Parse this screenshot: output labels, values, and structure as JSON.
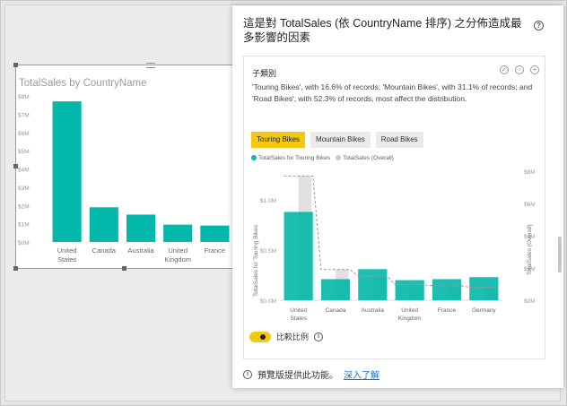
{
  "left_visual": {
    "title": "TotalSales by CountryName",
    "chart_data": {
      "type": "bar",
      "title": "TotalSales by CountryName",
      "categories": [
        "United States",
        "Canada",
        "Australia",
        "United Kingdom",
        "France"
      ],
      "category_lines": [
        [
          "United",
          "States"
        ],
        [
          "Canada"
        ],
        [
          "Australia"
        ],
        [
          "United",
          "Kingdom"
        ],
        [
          "France"
        ]
      ],
      "values": [
        7.7,
        1.9,
        1.5,
        0.95,
        0.9
      ],
      "y_ticks": [
        "$0M",
        "$1M",
        "$2M",
        "$3M",
        "$4M",
        "$5M",
        "$6M",
        "$7M",
        "$8M"
      ],
      "ylim": [
        0,
        8
      ],
      "color": "#01b8aa"
    }
  },
  "panel": {
    "title": "這是對 TotalSales (依 CountryName 排序) 之分佈造成最多影響的因素",
    "help_icon": "?",
    "card": {
      "heading": "子類別",
      "description": "'Touring Bikes', with 16.6% of records; 'Mountain Bikes', with 31.1% of records; and 'Road Bikes', with 52.3% of records, most affect the distribution.",
      "icons": [
        "thumbs-up-icon",
        "comment-icon",
        "add-icon"
      ],
      "buttons": [
        {
          "label": "Touring Bikes",
          "active": true
        },
        {
          "label": "Mountain Bikes",
          "active": false
        },
        {
          "label": "Road Bikes",
          "active": false
        }
      ],
      "legend": [
        {
          "label": "TotalSales for Touring Bikes",
          "color": "#01b8aa"
        },
        {
          "label": "TotalSales (Overall)",
          "color": "#c8c8c8"
        }
      ],
      "chart_data": {
        "type": "bar",
        "categories": [
          "United States",
          "Canada",
          "Australia",
          "United Kingdom",
          "France",
          "Germany"
        ],
        "category_lines": [
          [
            "United",
            "States"
          ],
          [
            "Canada"
          ],
          [
            "Australia"
          ],
          [
            "United",
            "Kingdom"
          ],
          [
            "France"
          ],
          [
            "Germany"
          ]
        ],
        "series": [
          {
            "name": "TotalSales for Touring Bikes",
            "axis": "left",
            "values": [
              0.88,
              0.21,
              0.31,
              0.2,
              0.21,
              0.23
            ],
            "color": "#01b8aa"
          },
          {
            "name": "TotalSales (Overall)",
            "axis": "right",
            "values": [
              7.7,
              1.9,
              1.5,
              0.95,
              0.9,
              0.8
            ],
            "color": "#c8c8c8"
          }
        ],
        "ylabel_left": "TotalSales for Touring Bikes",
        "ylabel_right": "TotalSales (Overall)",
        "y_left_ticks": [
          "$0.0M",
          "$0.5M",
          "$1.0M"
        ],
        "y_left_lim": [
          0,
          1.2
        ],
        "y_right_ticks": [
          "$0M",
          "$2M",
          "$4M",
          "$6M",
          "$8M"
        ],
        "y_right_lim": [
          0,
          8
        ]
      },
      "toggle_label": "比較比例",
      "toggle_on": true,
      "info_icon": "i"
    },
    "footer": {
      "text": "預覽版提供此功能。",
      "link": "深入了解",
      "info_icon": "i"
    }
  }
}
